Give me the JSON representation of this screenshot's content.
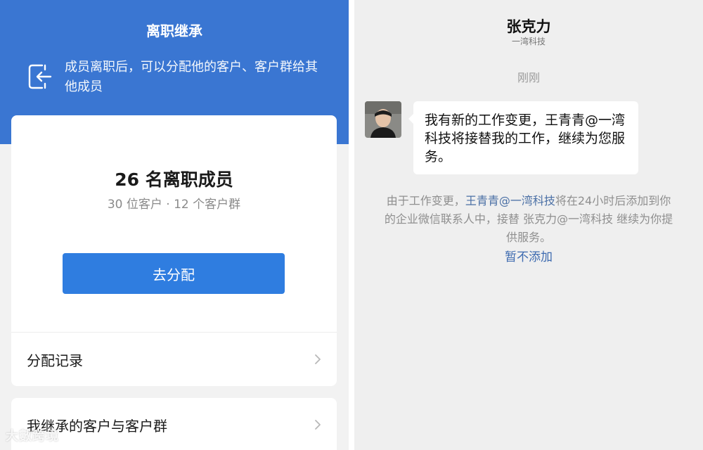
{
  "left": {
    "header": {
      "title": "离职继承",
      "description": "成员离职后，可以分配他的客户、客户群给其他成员"
    },
    "summary": {
      "title": "26 名离职成员",
      "subtitle": "30 位客户 · 12 个客户群",
      "assign_button": "去分配"
    },
    "rows": [
      {
        "label": "分配记录"
      },
      {
        "label": "我继承的客户与客户群"
      }
    ],
    "watermark": "大數跨境"
  },
  "right": {
    "contact": {
      "name": "张克力",
      "company": "一湾科技"
    },
    "time": "刚刚",
    "message": "我有新的工作变更，王青青@一湾科技将接替我的工作，继续为您服务。",
    "system_notice": {
      "prefix": "由于工作变更，",
      "link": "王青青@一湾科技",
      "suffix": "将在24小时后添加到你的企业微信联系人中，接替 张克力@一湾科技 继续为你提供服务。"
    },
    "defer_link": "暂不添加"
  },
  "colors": {
    "header_blue": "#3a76d2",
    "button_blue": "#2f7de0",
    "link_blue": "#3e6bb0"
  }
}
